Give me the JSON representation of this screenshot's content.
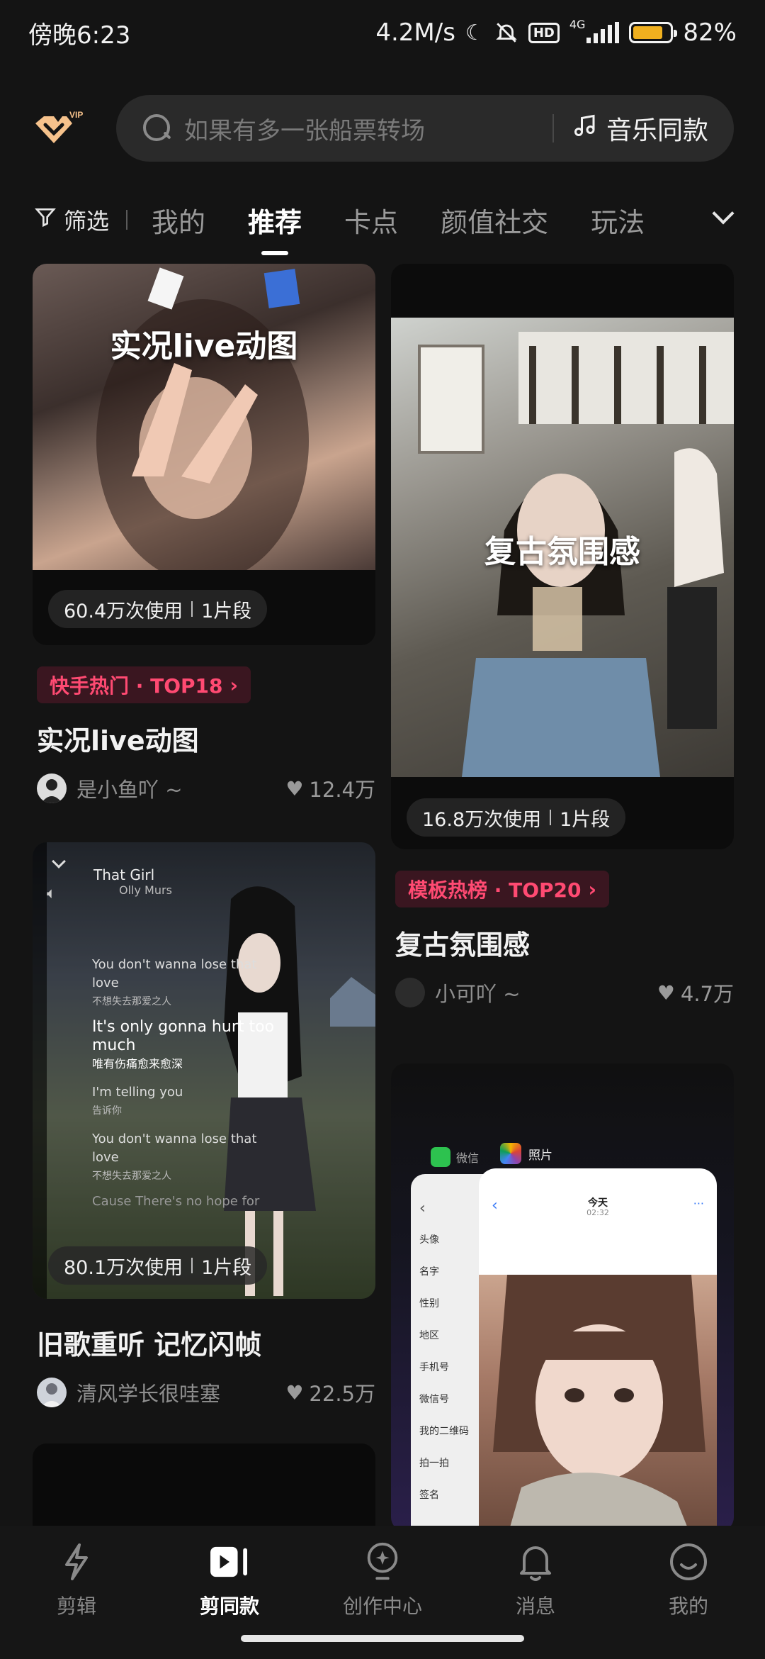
{
  "status_bar": {
    "time": "傍晚6:23",
    "network_speed": "4.2M/s",
    "hd_label": "HD",
    "signal_label": "4G",
    "battery_percent": "82%",
    "battery_level": 0.82
  },
  "header": {
    "vip_label": "VIP",
    "search_placeholder": "如果有多一张船票转场",
    "music_button": "音乐同款"
  },
  "tabs": {
    "filter_label": "筛选",
    "items": [
      {
        "label": "我的",
        "active": false
      },
      {
        "label": "推荐",
        "active": true
      },
      {
        "label": "卡点",
        "active": false
      },
      {
        "label": "颜值社交",
        "active": false
      },
      {
        "label": "玩法",
        "active": false
      }
    ]
  },
  "cards": [
    {
      "overlay_title": "实况live动图",
      "uses": "60.4万次使用",
      "clips": "1片段",
      "badge": "快手热门 · TOP18",
      "title": "实况live动图",
      "author": "是小鱼吖 ~",
      "likes": "12.4万"
    },
    {
      "overlay_title": "复古氛围感",
      "uses": "16.8万次使用",
      "clips": "1片段",
      "badge": "模板热榜 · TOP20",
      "title": "复古氛围感",
      "author": "小可吖 ~",
      "likes": "4.7万"
    },
    {
      "uses": "80.1万次使用",
      "clips": "1片段",
      "title": "旧歌重听 记忆闪帧",
      "author": "清风学长很哇塞",
      "likes": "22.5万",
      "lyrics": {
        "song": "That Girl",
        "artist": "Olly Murs",
        "lines": [
          "You don't wanna lose that love",
          "不想失去那爱之人",
          "It's only gonna hurt too much",
          "唯有伤痛愈来愈深",
          "I'm telling you",
          "告诉你",
          "You don't wanna lose that love",
          "不想失去那爱之人",
          "Cause There's no hope for"
        ]
      }
    },
    {
      "apps": {
        "wechat": "微信",
        "photos": "照片"
      },
      "screen_title": "今天",
      "screen_time": "02:32",
      "list_items": [
        "头像",
        "名字",
        "性别",
        "地区",
        "手机号",
        "微信号",
        "我的二维码",
        "拍一拍",
        "签名"
      ]
    }
  ],
  "bottom_nav": [
    {
      "label": "剪辑",
      "icon": "lightning-icon",
      "active": false
    },
    {
      "label": "剪同款",
      "icon": "template-play-icon",
      "active": true
    },
    {
      "label": "创作中心",
      "icon": "creator-bulb-icon",
      "active": false
    },
    {
      "label": "消息",
      "icon": "bell-icon",
      "active": false
    },
    {
      "label": "我的",
      "icon": "smile-face-icon",
      "active": false
    }
  ]
}
